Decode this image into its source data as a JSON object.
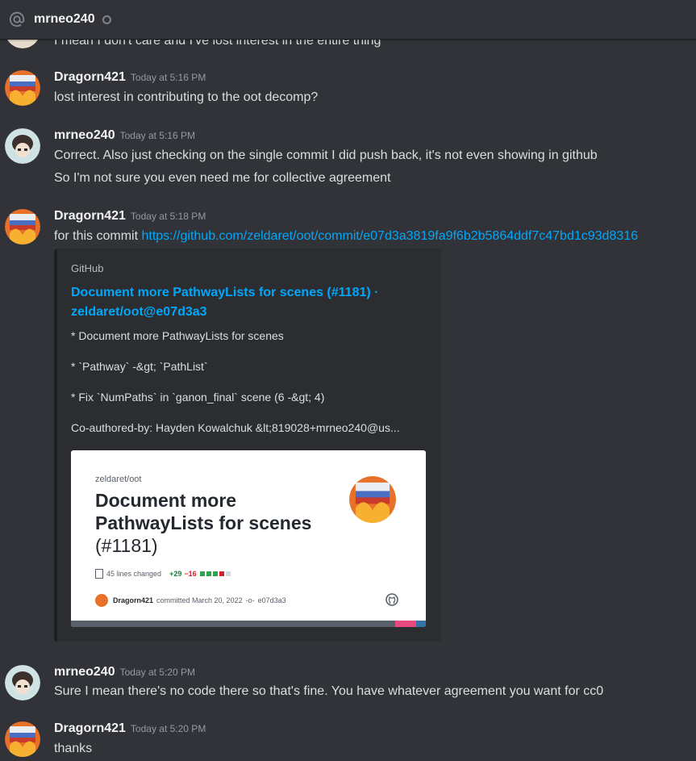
{
  "header": {
    "title": "mrneo240",
    "icon": "at-icon",
    "status": "offline"
  },
  "messages": [
    {
      "text": "I mean I don't care and I've lost interest in the entire thing"
    },
    {
      "author": "Dragorn421",
      "time": "Today at 5:16 PM",
      "lines": [
        "lost interest in contributing to the oot decomp?"
      ]
    },
    {
      "author": "mrneo240",
      "time": "Today at 5:16 PM",
      "lines": [
        "Correct. Also just checking on the single commit I did push back, it's not even showing in github",
        "So I'm not sure you even need me for collective agreement"
      ]
    },
    {
      "author": "Dragorn421",
      "time": "Today at 5:18 PM",
      "text_prefix": "for this commit ",
      "link": "https://github.com/zeldaret/oot/commit/e07d3a3819fa9f6b2b5864ddf7c47bd1c93d8316"
    },
    {
      "author": "mrneo240",
      "time": "Today at 5:20 PM",
      "lines": [
        "Sure I mean there's no code there so that's fine. You have whatever agreement you want for cc0"
      ]
    },
    {
      "author": "Dragorn421",
      "time": "Today at 5:20 PM",
      "lines": [
        "thanks"
      ]
    }
  ],
  "embed": {
    "provider": "GitHub",
    "title": "Document more PathwayLists for scenes (#1181) · zeldaret/oot@e07d3a3",
    "desc": [
      "* Document more PathwayLists for scenes",
      "* `Pathway` -&gt; `PathList`",
      "* Fix `NumPaths` in `ganon_final` scene (6 -&gt; 4)",
      "Co-authored-by: Hayden Kowalchuk &lt;819028+mrneo240@us..."
    ],
    "card": {
      "repo": "zeldaret/oot",
      "title": "Document more PathwayLists for scenes",
      "number": "(#1181)",
      "lines_changed": "45 lines changed",
      "additions": "+29",
      "deletions": "−16",
      "author": "Dragorn421",
      "committed": "committed March 20, 2022",
      "sha": "e07d3a3"
    }
  },
  "colors": {
    "link": "#00a8fc",
    "background": "#313338",
    "embed": "#2b2d31"
  }
}
